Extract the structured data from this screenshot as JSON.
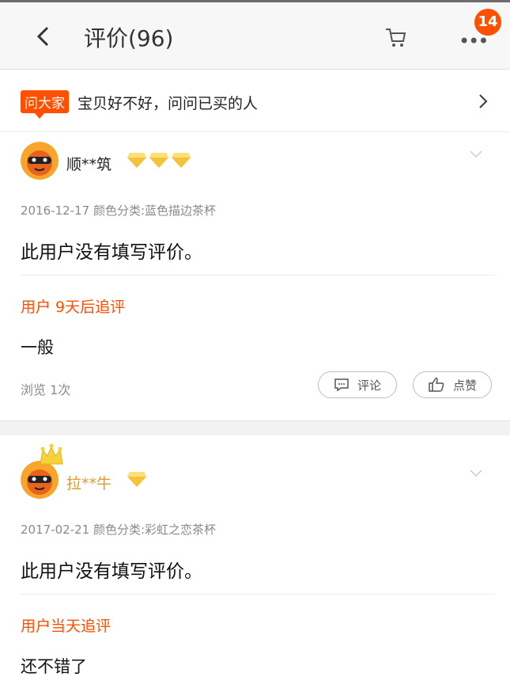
{
  "header": {
    "title": "评价(96)",
    "badge_count": "14",
    "more_label": "•••"
  },
  "ask": {
    "tag": "问大家",
    "text": "宝贝好不好，问问已买的人"
  },
  "reviews": [
    {
      "username": "顺**筑",
      "gem_count": 3,
      "meta": "2016-12-17 颜色分类:蓝色描边茶杯",
      "content": "此用户没有填写评价。",
      "follow_label": "用户 9天后追评",
      "follow_text": "一般",
      "views": "浏览 1次",
      "comment_label": "评论",
      "like_label": "点赞"
    },
    {
      "username": "拉**牛",
      "gem_count": 1,
      "meta": "2017-02-21 颜色分类:彩虹之恋茶杯",
      "content": "此用户没有填写评价。",
      "follow_label": "用户当天追评",
      "follow_text": "还不错了"
    }
  ],
  "colors": {
    "accent": "#ff5000",
    "gem": "#f4c33a"
  }
}
